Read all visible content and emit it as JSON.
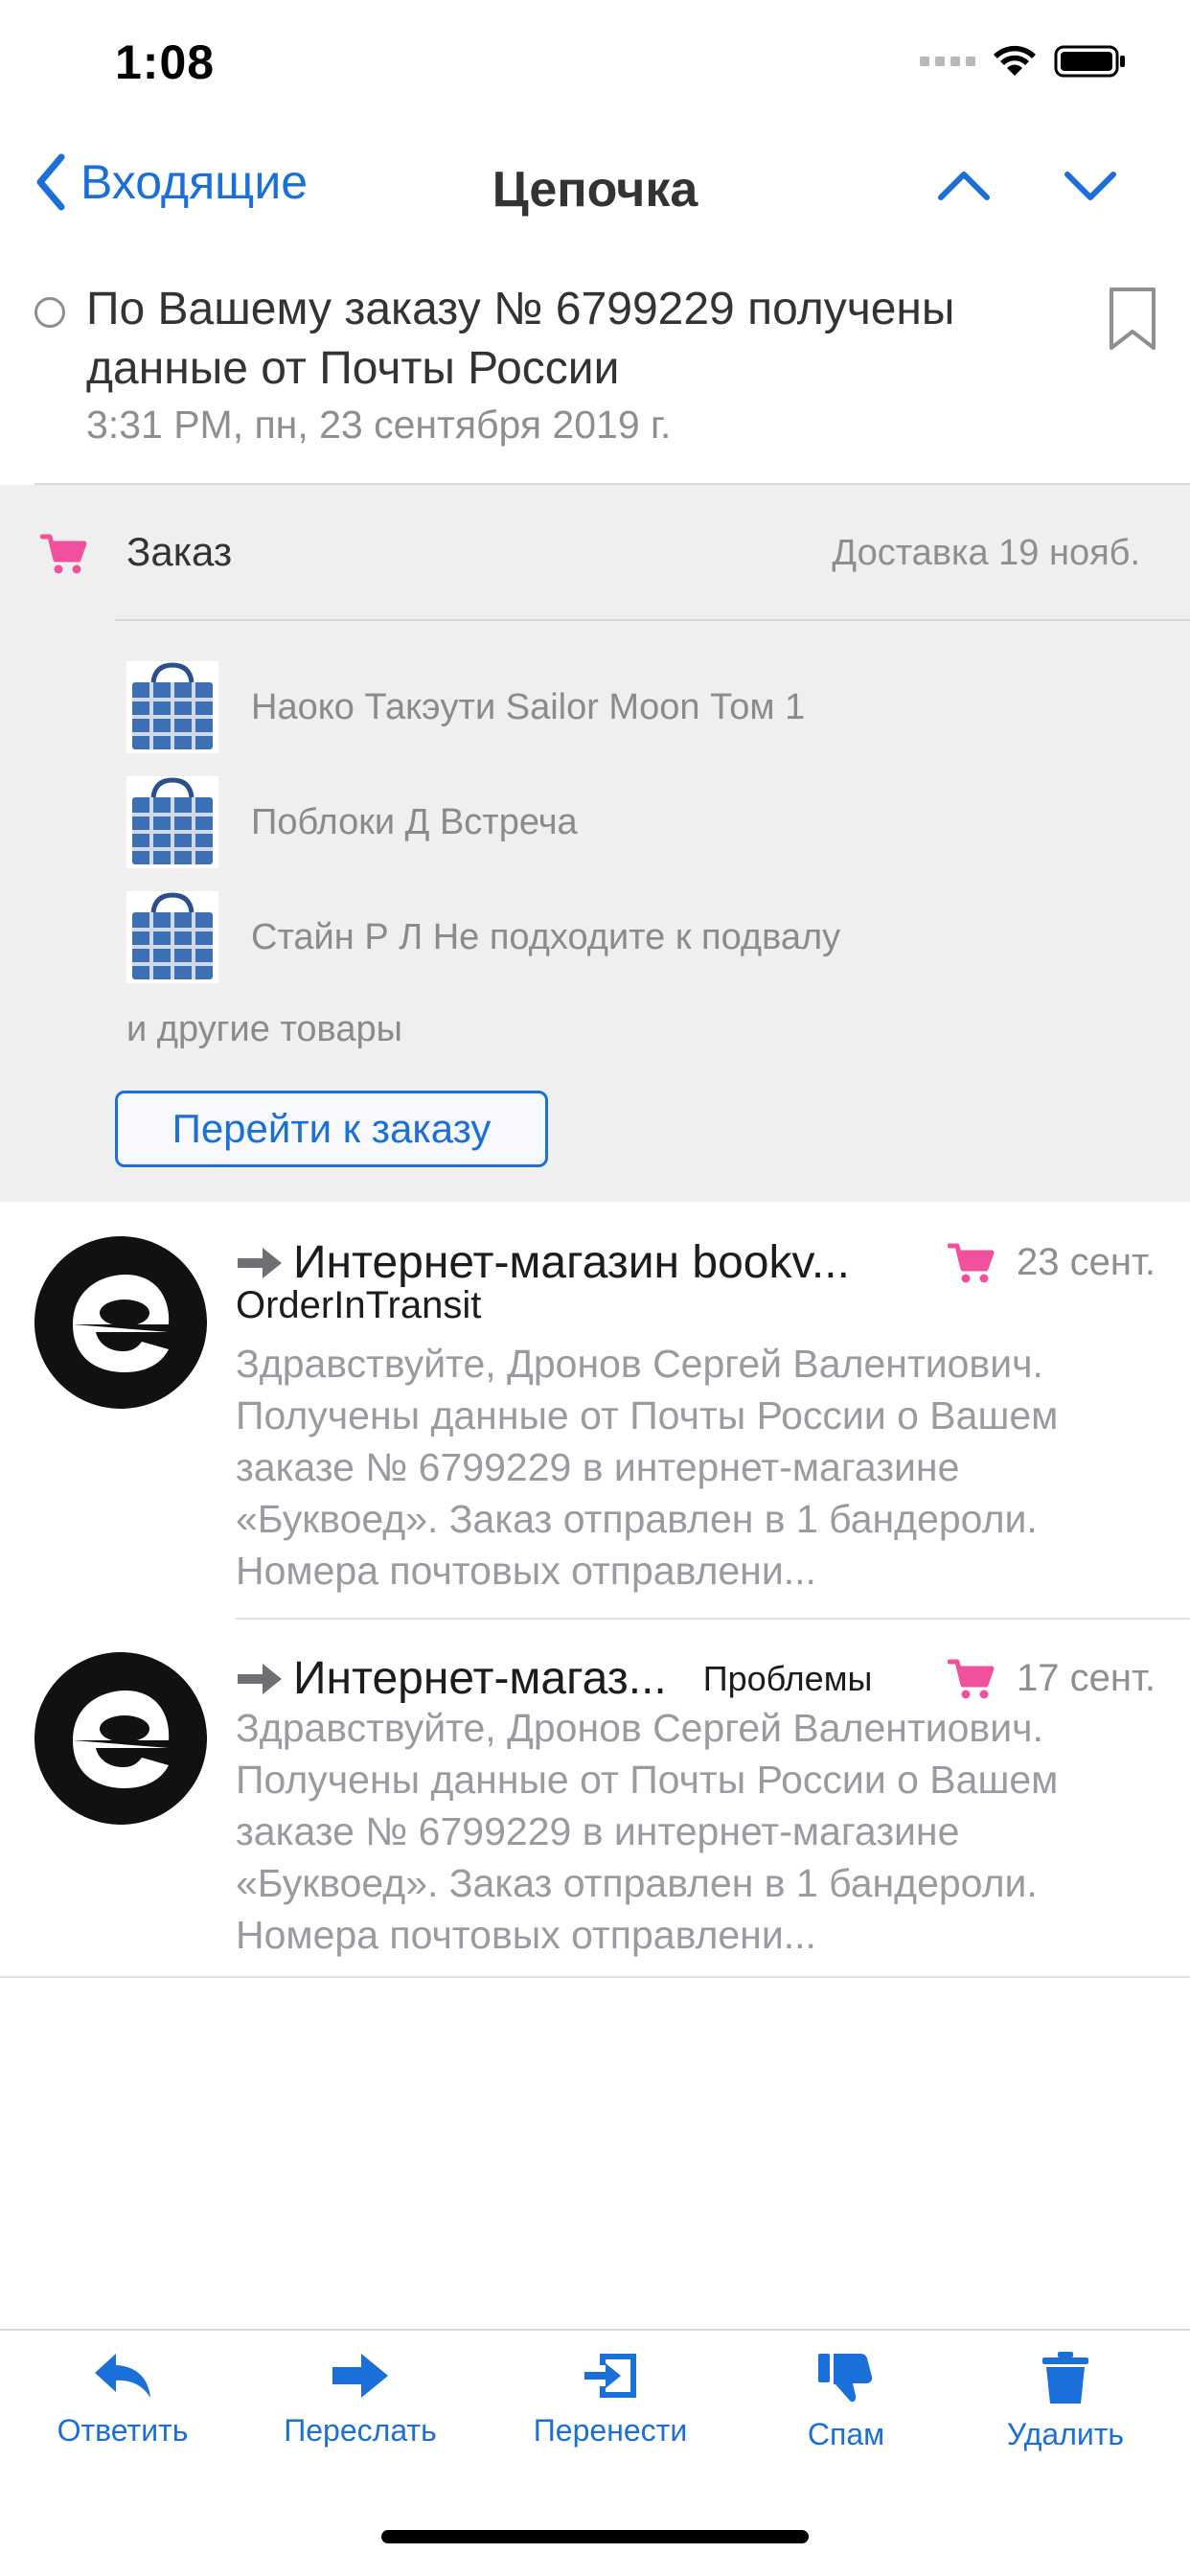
{
  "status_bar": {
    "time": "1:08"
  },
  "nav": {
    "back_label": "Входящие",
    "title": "Цепочка"
  },
  "thread": {
    "subject": "По Вашему заказу № 6799229 получены данные от Почты России",
    "date": "3:31 PM, пн, 23 сентября 2019 г."
  },
  "order": {
    "title": "Заказ",
    "delivery": "Доставка 19 нояб.",
    "items": [
      {
        "label": "Наоко Такэути Sailor Moon Том 1"
      },
      {
        "label": "Поблоки Д Встреча"
      },
      {
        "label": "Стайн Р Л Не подходите к подвалу"
      }
    ],
    "others": "и другие товары",
    "button": "Перейти к заказу"
  },
  "messages": [
    {
      "sender": "Интернет-магазин bookv...",
      "date": "23 сент.",
      "subject": "OrderInTransit",
      "tag": "",
      "body": "Здравствуйте, Дронов Сергей Валентиович. Получены данные от Почты России о Вашем заказе № 6799229 в интернет-магазине «Буквоед». Заказ отправлен в 1 бандероли. Номера почтовых отправлени..."
    },
    {
      "sender": "Интернет-магаз...",
      "date": "17 сент.",
      "subject": "",
      "tag": "Проблемы",
      "body": "Здравствуйте, Дронов Сергей Валентиович. Получены данные от Почты России о Вашем заказе № 6799229 в интернет-магазине «Буквоед». Заказ отправлен в 1 бандероли. Номера почтовых отправлени..."
    }
  ],
  "toolbar": {
    "reply": "Ответить",
    "forward": "Переслать",
    "move": "Перенести",
    "spam": "Спам",
    "delete": "Удалить"
  },
  "colors": {
    "accent": "#1a6fd8",
    "cart": "#f0509c",
    "panel": "#efefef"
  }
}
